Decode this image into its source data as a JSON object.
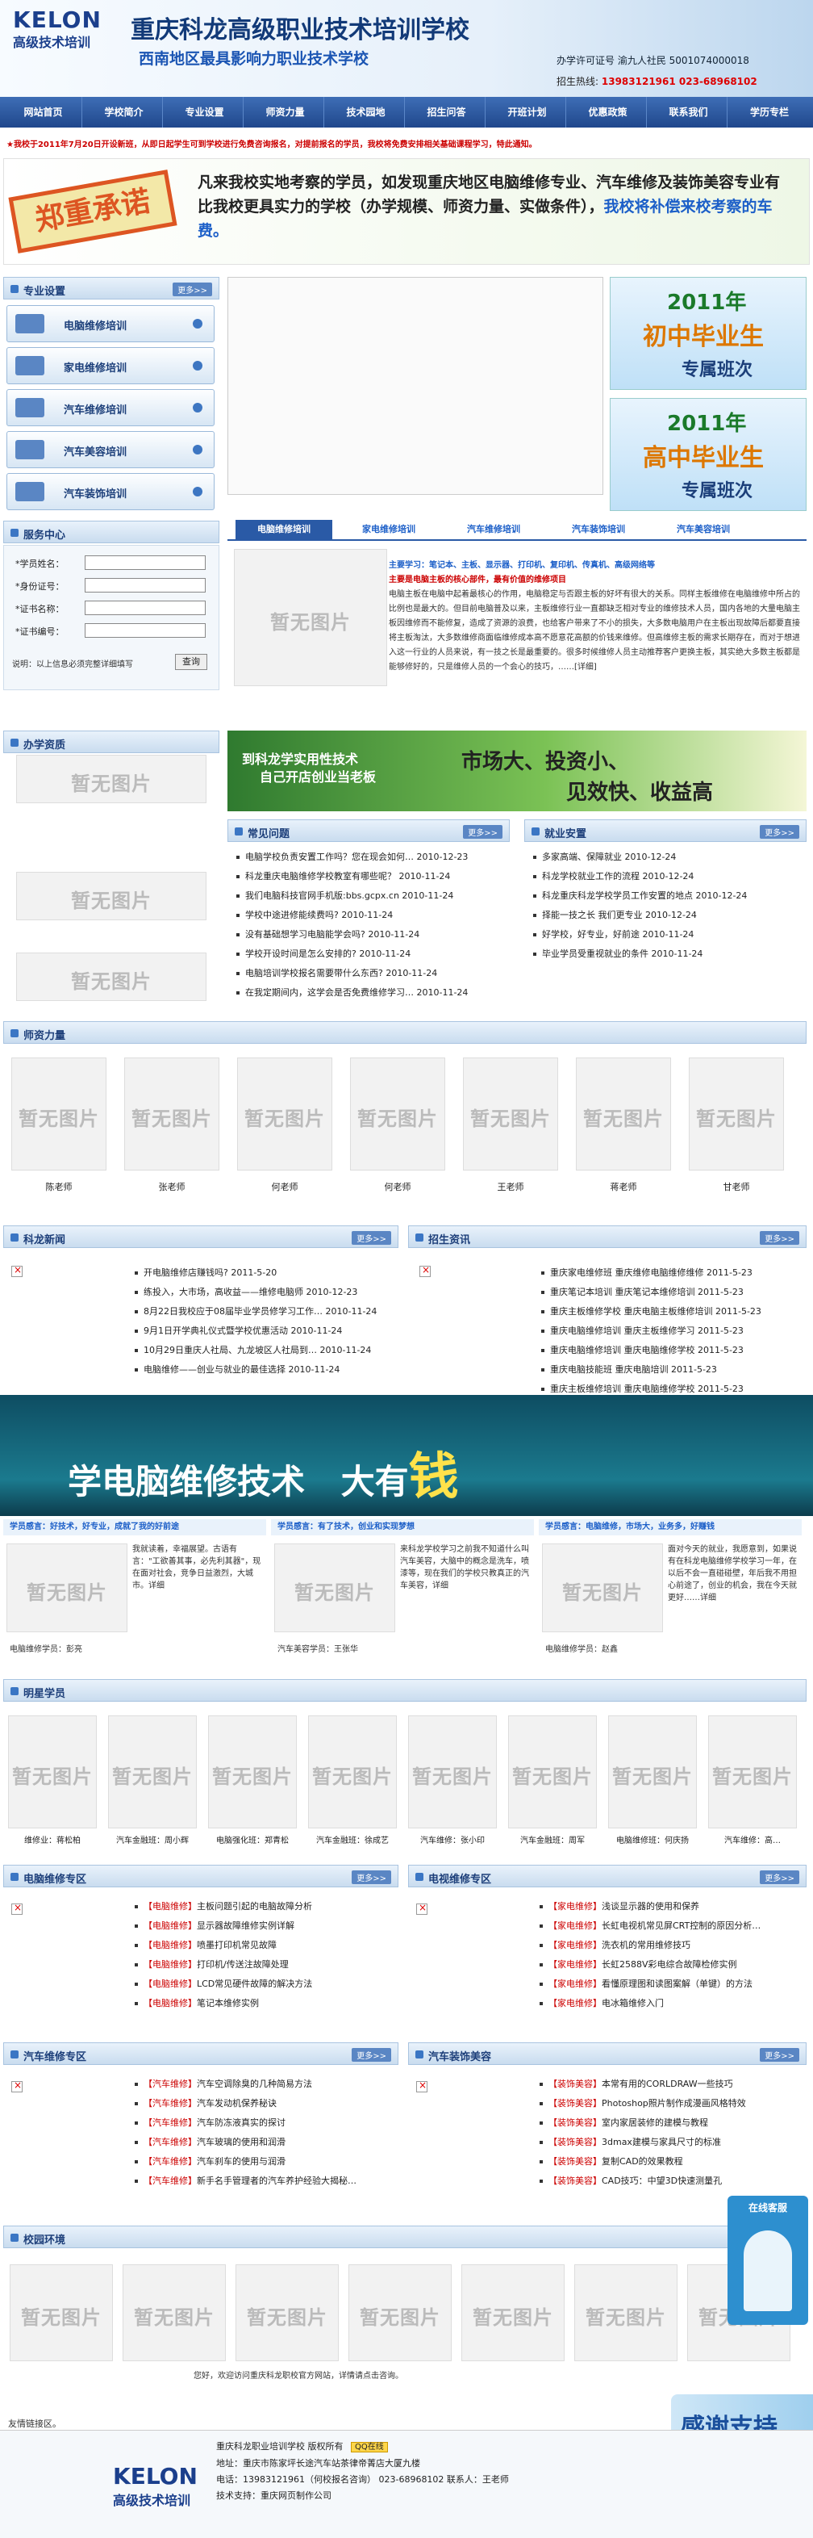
{
  "header": {
    "logo": "KELON",
    "logo_sub": "高级技术培训",
    "title": "重庆科龙高级职业技术培训学校",
    "subtitle": "西南地区最具影响力职业技术学校",
    "license": "办学许可证号 渝九人社民 5001074000018",
    "hotline_label": "招生热线:",
    "hotline": "13983121961  023-68968102"
  },
  "nav": [
    "网站首页",
    "学校简介",
    "专业设置",
    "师资力量",
    "技术园地",
    "招生问答",
    "开班计划",
    "优惠政策",
    "联系我们",
    "学历专栏"
  ],
  "notice": "★我校于2011年7月20日开设新班，从即日起学生可到学校进行免费咨询报名，对提前报名的学员，我校将免费安排相关基础课程学习，特此通知。",
  "promise": {
    "stamp": "郑重承诺",
    "text_a": "凡来我校实地考察的学员，如发现重庆地区电脑维修专业、汽车维修及装饰美容专业有比我校更具实力的学校（办学规模、师资力量、实做条件），",
    "text_b": "我校将补偿来校考察的车费。"
  },
  "sidebar": {
    "majors_title": "专业设置",
    "more": "更多>>",
    "majors": [
      "电脑维修培训",
      "家电维修培训",
      "汽车维修培训",
      "汽车美容培训",
      "汽车装饰培训"
    ],
    "service_title": "服务中心",
    "fields": [
      "*学员姓名：",
      "*身份证号：",
      "*证书名称：",
      "*证书编号："
    ],
    "note": "说明：以上信息必须完整详细填写",
    "query": "查询",
    "env_title": "办学资质"
  },
  "placeholder": "暂无图片",
  "side_ads": [
    {
      "year": "2011年",
      "main": "初中毕业生",
      "sub": "专属班次"
    },
    {
      "year": "2011年",
      "main": "高中毕业生",
      "sub": "专属班次"
    }
  ],
  "tabs": [
    "电脑维修培训",
    "家电维修培训",
    "汽车维修培训",
    "汽车装饰培训",
    "汽车美容培训"
  ],
  "tab_content": {
    "title": "主要学习：笔记本、主板、显示器、打印机、复印机、传真机、高级网络等",
    "subtitle": "主要是电脑主板的核心部件，最有价值的维修项目",
    "body": "电脑主板在电脑中起着最核心的作用，电脑稳定与否跟主板的好坏有很大的关系。同样主板维修在电脑维修中所占的比例也是最大的。但目前电脑普及以来，主板维修行业一直都缺乏相对专业的维修技术人员，国内各地的大量电脑主板因维修而不能修复，造成了资源的浪费，也给客户带来了不小的损失，大多数电脑用户在主板出现故障后都要直接将主板淘汰，大多数维修商面临维修成本高不愿意花高额的价钱来维修。但高维修主板的需求长期存在，而对于想进入这一行业的人员来说，有一技之长是最重要的。很多时候维修人员主动推荐客户更换主板，其实绝大多数主板都是能够修好的，只是维修人员的一个会心的技巧，……[详细]"
  },
  "banner1": {
    "left": "到科龙学实用性技术",
    "left2": "自己开店创业当老板",
    "right1": "市场大、投资小、",
    "right2": "见效快、收益高"
  },
  "faq": {
    "title": "常见问题",
    "more": "更多>>",
    "items": [
      "电脑学校负责安置工作吗？您在现会如何…  2010-12-23",
      "科龙重庆电脑维修学校教室有哪些呢？  2010-11-24",
      "我们电脑科技官网手机版:bbs.gcpx.cn  2010-11-24",
      "学校中途进修能续费吗?  2010-11-24",
      "没有基础想学习电脑能学会吗?  2010-11-24",
      "学校开设时间是怎么安排的?  2010-11-24",
      "电脑培训学校报名需要带什么东西?  2010-11-24",
      "在我定期间内，这学会是否免费维修学习…  2010-11-24"
    ]
  },
  "jobs": {
    "title": "就业安置",
    "more": "更多>>",
    "items": [
      "多家高端、保障就业  2010-12-24",
      "科龙学校就业工作的流程  2010-12-24",
      "科龙重庆科龙学校学员工作安置的地点  2010-12-24",
      "择能一技之长 我们更专业  2010-12-24",
      "好学校，好专业，好前途  2010-11-24",
      "毕业学员受重视就业的条件  2010-11-24"
    ]
  },
  "teachers": {
    "title": "师资力量",
    "names": [
      "陈老师",
      "张老师",
      "何老师",
      "何老师",
      "王老师",
      "蒋老师",
      "甘老师"
    ]
  },
  "news": {
    "title": "科龙新闻",
    "more": "更多>>",
    "items": [
      "开电脑维修店赚钱吗?  2011-5-20",
      "练投入，大市场，高收益——维修电脑师  2010-12-23",
      "8月22日我校应于08届毕业学员修学习工作…  2010-11-24",
      "9月1日开学典礼仪式暨学校优惠活动  2010-11-24",
      "10月29日重庆人社局、九龙坡区人社局到…  2010-11-24",
      "电脑维修——创业与就业的最佳选择  2010-11-24"
    ]
  },
  "enroll": {
    "title": "招生资讯",
    "more": "更多>>",
    "items": [
      "重庆家电维修班 重庆维修电脑维修维修  2011-5-23",
      "重庆笔记本培训 重庆笔记本维修培训  2011-5-23",
      "重庆主板维修学校 重庆电脑主板维修培训  2011-5-23",
      "重庆电脑维修培训 重庆主板维修学习  2011-5-23",
      "重庆电脑维修培训 重庆电脑维修学校  2011-5-23",
      "重庆电脑技能班 重庆电脑培训  2011-5-23",
      "重庆主板维修培训 重庆电脑维修学校  2011-5-23",
      "重庆数据恢复 重庆数据恢复培训课程  2011-5-23"
    ]
  },
  "banner2": {
    "text_a": "学电脑维修技术",
    "text_b": "大有",
    "text_c": "钱"
  },
  "testimonials": [
    {
      "head": "学员感言：好技术，好专业，成就了我的好前途",
      "body": "我就读着，幸福展望。古语有言：\"工欲善其事，必先利其器\"，现在面对社会，竞争日益激烈，大城市。详细",
      "who": "电脑维修学员：彭亮"
    },
    {
      "head": "学员感言：有了技术，创业和实现梦想",
      "body": "来科龙学校学习之前我不知道什么叫汽车美容，大脑中的概念是洗车，喷漆等，现在我们的学校只教真正的汽车美容，详细",
      "who": "汽车美容学员：王张华"
    },
    {
      "head": "学员感言：电脑维修，市场大，业务多，好赚钱",
      "body": "面对今天的就业，我愿意到，如果说有在科龙电脑维修学校学习一年，在以后不会一直碰碰壁，年后我不用担心前途了，创业的机会，我在今天就更好……详细",
      "who": "电脑维修学员：赵鑫"
    }
  ],
  "stars": {
    "title": "明星学员",
    "labels": [
      "维修业：蒋松柏",
      "汽车金融班：周小辉",
      "电脑强化班：郑青松",
      "汽车金融班：徐成艺",
      "汽车维修：张小印",
      "汽车金融班：周军",
      "电脑维修班：何庆扬",
      "汽车维修：高…"
    ]
  },
  "pc_repair": {
    "title": "电脑维修专区",
    "more": "更多>>",
    "items": [
      "【电脑维修】主板问题引起的电脑故障分析",
      "【电脑维修】显示器故障维修实例详解",
      "【电脑维修】喷墨打印机常见故障",
      "【电脑维修】打印机/传送注故障处理",
      "【电脑维修】LCD常见硬件故障的解决方法",
      "【电脑维修】笔记本维修实例"
    ]
  },
  "appliance": {
    "title": "电视维修专区",
    "more": "更多>>",
    "items": [
      "【家电维修】浅谈显示器的使用和保养",
      "【家电维修】长虹电视机常见屏CRT控制的原因分析…",
      "【家电维修】洗衣机的常用维修技巧",
      "【家电维修】长虹2588V彩电综合故障检修实例",
      "【家电维修】看懂原理图和读图案解（单键）的方法",
      "【家电维修】电冰箱维修入门"
    ]
  },
  "car_repair": {
    "title": "汽车维修专区",
    "more": "更多>>",
    "items": [
      "【汽车维修】汽车空调除臭的几种简易方法",
      "【汽车维修】汽车发动机保养秘诀",
      "【汽车维修】汽车防冻液真实的探讨",
      "【汽车维修】汽车玻璃的使用和润滑",
      "【汽车维修】汽车刹车的使用与润滑",
      "【汽车维修】新手名手管理者的汽车养护经验大揭秘…"
    ]
  },
  "car_decor": {
    "title": "汽车装饰美容",
    "more": "更多>>",
    "items": [
      "【装饰美容】本常有用的CORLDRAW一些技巧",
      "【装饰美容】Photoshop照片制作成漫画风格特效",
      "【装饰美容】室内家居装修的建模与教程",
      "【装饰美容】3dmax建模与家具尺寸的标准",
      "【装饰美容】复制CAD的效果教程",
      "【装饰美容】CAD技巧：中望3D快速测量孔"
    ]
  },
  "online": "在线客服",
  "campus": {
    "title": "校园环境"
  },
  "welcome": "您好，欢迎访问重庆科龙职校官方网站，详情请点击咨询。",
  "thanks": "感谢支持",
  "links": "友情链接区。",
  "footer": {
    "line1": "重庆科龙职业培训学校  版权所有",
    "qq": "QQ在线",
    "line2": "地址：重庆市陈家坪长途汽车站茶律帝菁店大厦九楼",
    "line3": "电话：13983121961（何校报名咨询）  023-68968102  联系人：王老师",
    "line4": "技术支持：重庆网页制作公司"
  }
}
